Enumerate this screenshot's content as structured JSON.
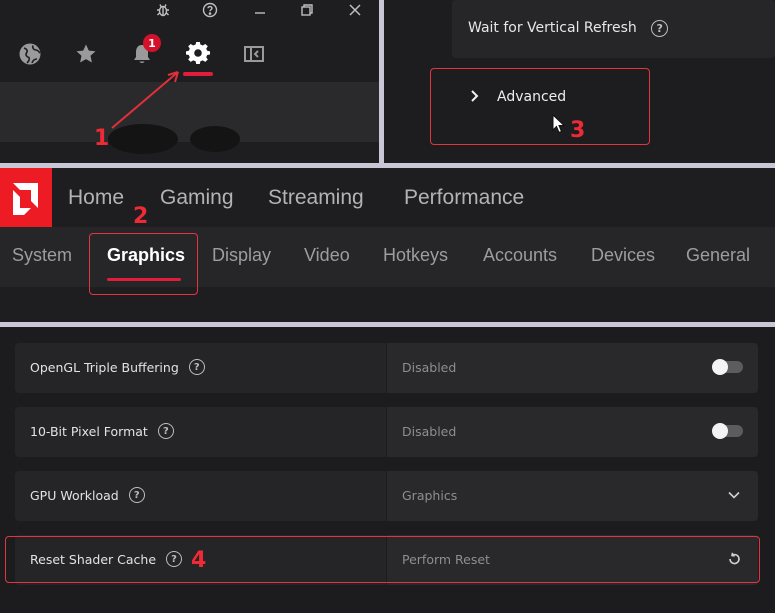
{
  "steps": [
    "1",
    "2",
    "3",
    "4"
  ],
  "toolbar": {
    "window_icons": [
      "bug-icon",
      "help-icon",
      "minimize-icon",
      "restore-icon",
      "close-icon"
    ],
    "icons": [
      "globe-icon",
      "star-icon",
      "bell-icon",
      "gear-icon",
      "sidebar-icon"
    ],
    "notification_count": "1"
  },
  "advanced_panel": {
    "vertical_refresh_label": "Wait for Vertical Refresh",
    "advanced_label": "Advanced"
  },
  "nav": {
    "main_tabs": [
      "Home",
      "Gaming",
      "Streaming",
      "Performance"
    ],
    "sub_tabs": [
      "System",
      "Graphics",
      "Display",
      "Video",
      "Hotkeys",
      "Accounts",
      "Devices",
      "General"
    ],
    "active_sub_tab": "Graphics"
  },
  "settings": [
    {
      "label": "OpenGL Triple Buffering",
      "value": "Disabled",
      "control": "toggle"
    },
    {
      "label": "10-Bit Pixel Format",
      "value": "Disabled",
      "control": "toggle"
    },
    {
      "label": "GPU Workload",
      "value": "Graphics",
      "control": "dropdown"
    },
    {
      "label": "Reset Shader Cache",
      "value": "Perform Reset",
      "control": "reset"
    }
  ],
  "colors": {
    "accent": "#ed1c24",
    "highlight_box": "#e1363f",
    "step_number": "#ee2a36",
    "badge": "#d3112a"
  }
}
